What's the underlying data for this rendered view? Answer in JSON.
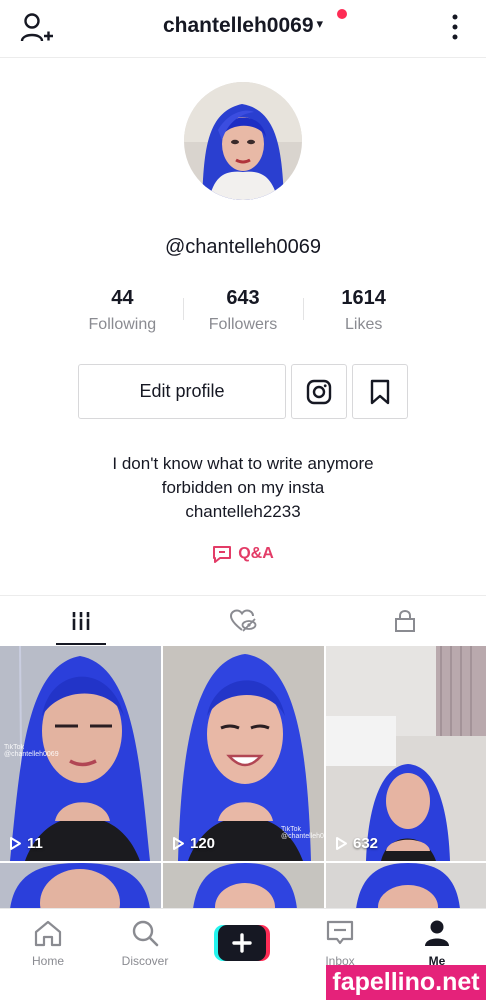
{
  "header": {
    "username": "chantelleh0069",
    "caret": "▾"
  },
  "profile": {
    "handle": "@chantelleh0069",
    "stats": [
      {
        "value": "44",
        "label": "Following"
      },
      {
        "value": "643",
        "label": "Followers"
      },
      {
        "value": "1614",
        "label": "Likes"
      }
    ],
    "edit_label": "Edit profile",
    "bio_lines": [
      "I don't know what to write anymore",
      "forbidden on my insta",
      "chantelleh2233"
    ],
    "qa_label": "Q&A"
  },
  "videos": [
    {
      "views": "11"
    },
    {
      "views": "120"
    },
    {
      "views": "632"
    }
  ],
  "watermarks": {
    "tiktok": "TikTok",
    "tiktok_handle": "@chantelleh0069"
  },
  "nav": {
    "home": "Home",
    "discover": "Discover",
    "inbox": "Inbox",
    "me": "Me"
  },
  "site_watermark": "fapellino.net",
  "colors": {
    "accent": "#fe2c55",
    "qa": "#e33c67",
    "hair": "#2c3bd6"
  },
  "icons": [
    "add-user-icon",
    "kebab-icon",
    "instagram-icon",
    "bookmark-icon",
    "qa-icon",
    "grid-icon",
    "liked-hidden-icon",
    "lock-icon",
    "play-icon",
    "home-icon",
    "discover-icon",
    "create-icon",
    "inbox-icon",
    "me-icon"
  ]
}
